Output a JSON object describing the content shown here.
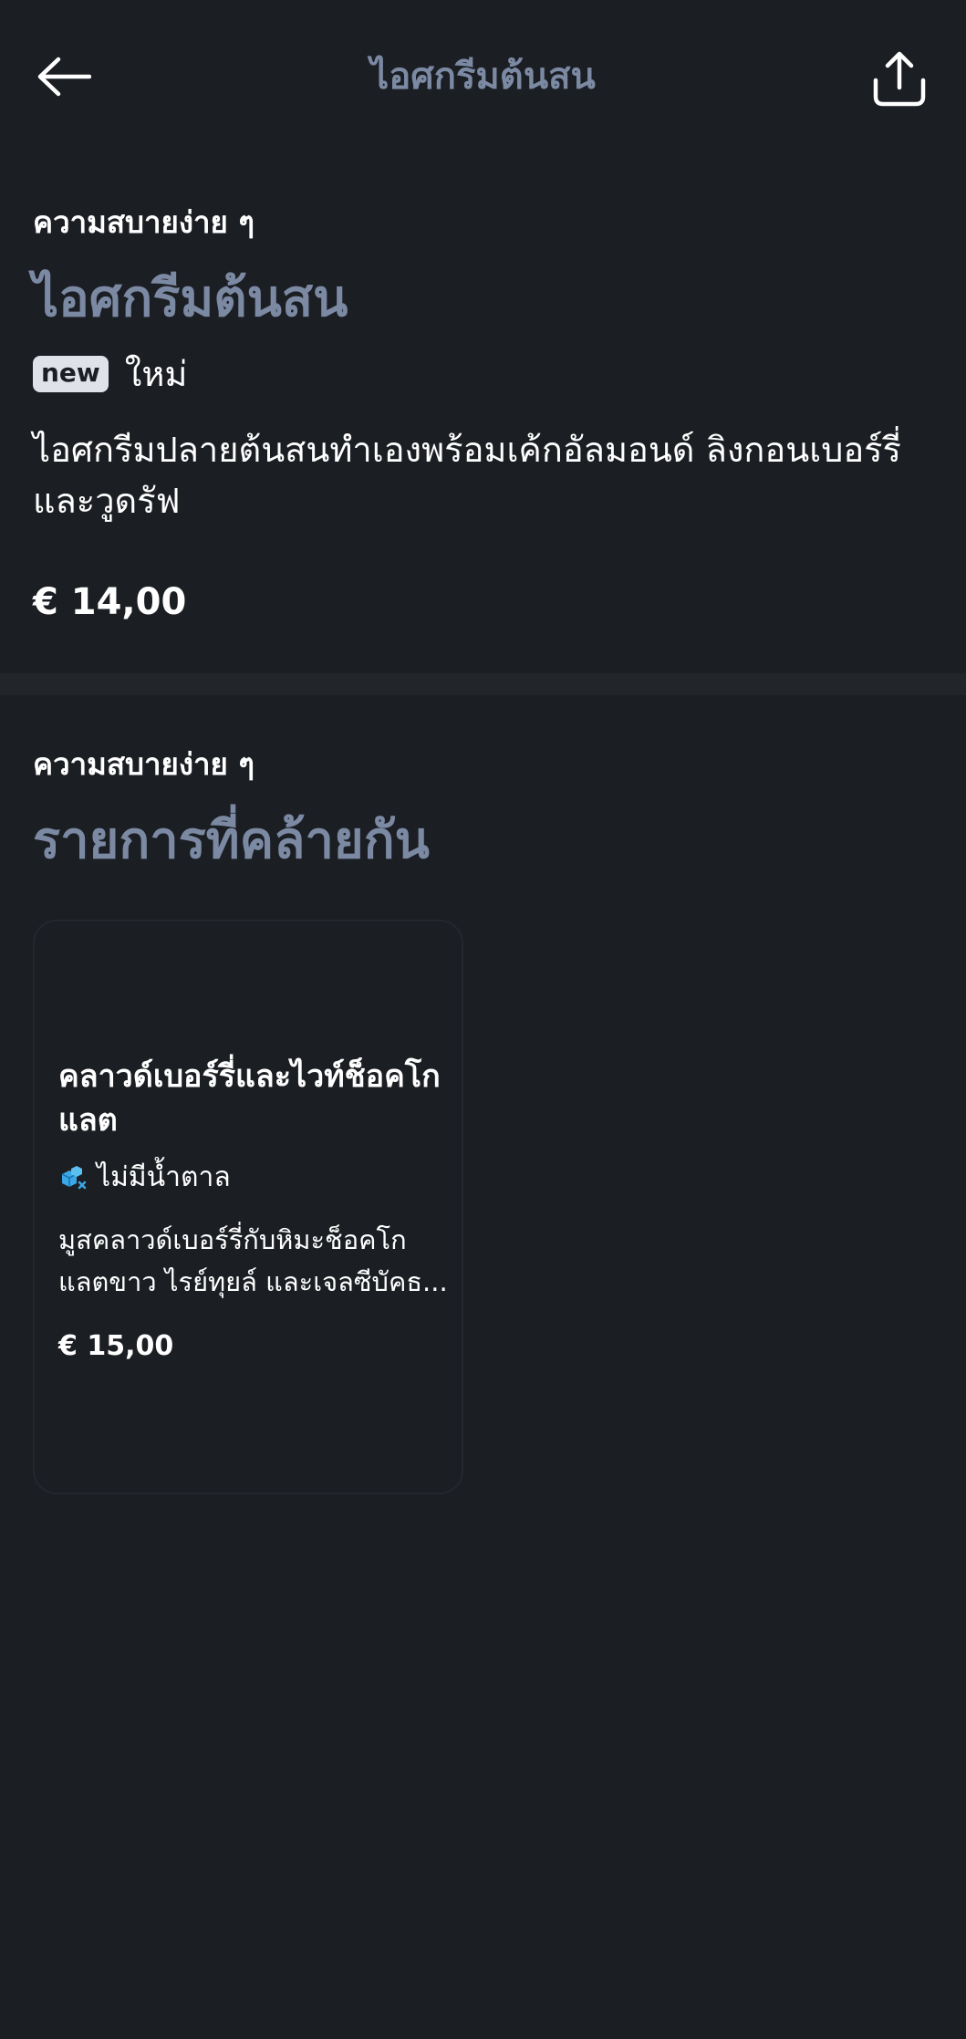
{
  "header": {
    "title": "ไอศกรีมต้นสน",
    "back_icon": "arrow-left-icon",
    "share_icon": "share-icon"
  },
  "product": {
    "category": "ความสบายง่าย ๆ",
    "name": "ไอศกรีมต้นสน",
    "badge": "new",
    "badge_label": "ใหม่",
    "description_lines": [
      "ไอศกรีมปลายต้นสนทำเองพร้อมเค้กอัลมอนด์ ลิงกอนเบอร์รี่",
      "และวูดรัฟ"
    ],
    "price": "€ 14,00"
  },
  "similar": {
    "category": "ความสบายง่าย ๆ",
    "title": "รายการที่คล้ายกัน",
    "items": [
      {
        "name_lines": [
          "คลาวด์เบอร์รี่และไวท์ช็อคโก",
          "แลต"
        ],
        "tag_icon": "sugar-free-icon",
        "tag_label": "ไม่มีน้ำตาล",
        "description_lines": [
          "มูสคลาวด์เบอร์รี่กับหิมะช็อคโก",
          "แลตขาว ไรย์ทุยล์ และเจลซีบัคธ..."
        ],
        "price": "€ 15,00"
      }
    ]
  },
  "colors": {
    "background": "#1b1e23",
    "accent_title": "#7b89a3",
    "badge_bg": "#dfe2e8",
    "tag_icon_blue": "#3aa7e6"
  }
}
